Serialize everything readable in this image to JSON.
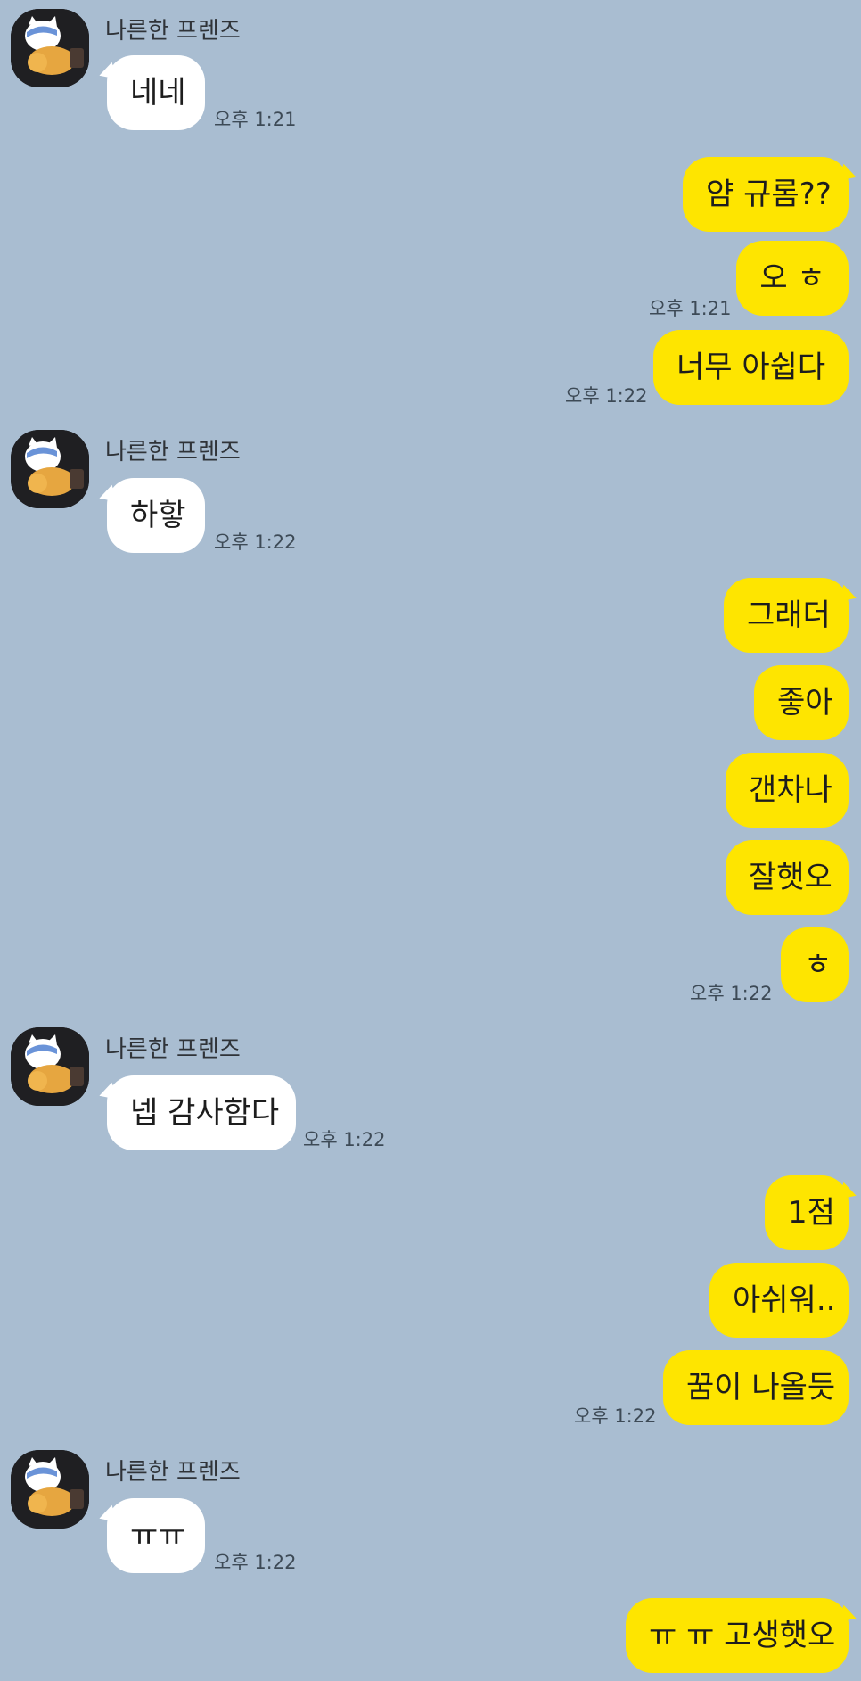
{
  "chat": {
    "friend_name": "나른한 프렌즈",
    "g1": {
      "m1": "네네",
      "time": "오후 1:21"
    },
    "g2": {
      "m1": "얌 규롬??",
      "m2": "오 ㅎ",
      "time": "오후 1:21"
    },
    "g3": {
      "m1": "너무 아쉽다",
      "time": "오후 1:22"
    },
    "g4": {
      "m1": "하핳",
      "time": "오후 1:22"
    },
    "g5": {
      "m1": "그래더",
      "m2": "좋아",
      "m3": "갠차나",
      "m4": "잘햇오",
      "m5": "ㅎ",
      "time": "오후 1:22"
    },
    "g6": {
      "m1": "넵 감사함다",
      "time": "오후 1:22"
    },
    "g7": {
      "m1": "1점",
      "m2": "아쉬워..",
      "m3": "꿈이 나올듯",
      "time": "오후 1:22"
    },
    "g8": {
      "m1": "ㅠㅠ",
      "time": "오후 1:22"
    },
    "g9": {
      "m1": "ㅠ ㅠ 고생햇오"
    }
  },
  "colors": {
    "background": "#a9bdd1",
    "incoming_bubble": "#ffffff",
    "outgoing_bubble": "#fee500",
    "avatar_bg": "#1f1f22"
  },
  "icons": {
    "avatar": "friend-profile-avatar-icon"
  }
}
